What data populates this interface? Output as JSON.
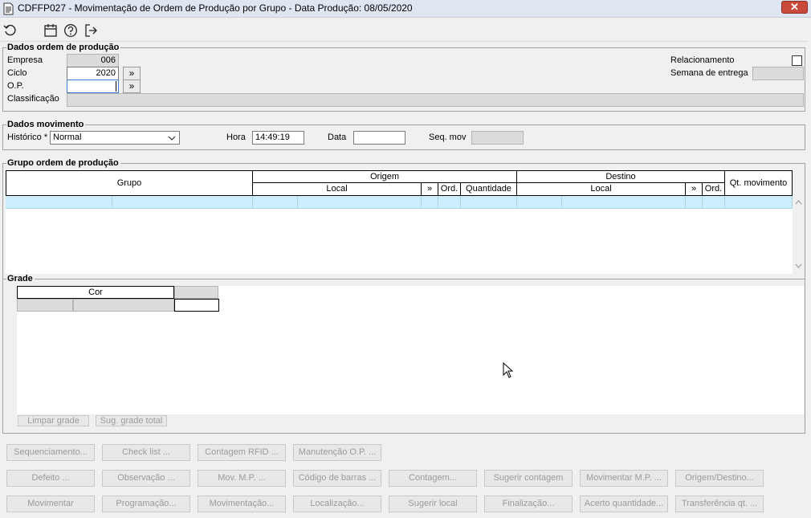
{
  "window": {
    "title": "CDFFP027 - Movimentação de Ordem de Produção por Grupo - Data Produção: 08/05/2020",
    "close_label": "✕"
  },
  "toolbar": {
    "icons": [
      "refresh-icon",
      "calendar-icon",
      "help-icon",
      "exit-icon"
    ]
  },
  "dados_ordem": {
    "title": "Dados ordem de produção",
    "empresa_label": "Empresa",
    "empresa_value": "006",
    "ciclo_label": "Ciclo",
    "ciclo_value": "2020",
    "op_label": "O.P.",
    "op_value": "",
    "classificacao_label": "Classificação",
    "relacionamento_label": "Relacionamento",
    "semana_label": "Semana de entrega",
    "lookup_glyph": "»"
  },
  "dados_movimento": {
    "title": "Dados movimento",
    "historico_label": "Histórico *",
    "historico_value": "Normal",
    "hora_label": "Hora",
    "hora_value": "14:49:19",
    "data_label": "Data",
    "data_value": "",
    "seq_label": "Seq. mov"
  },
  "grupo_ordem": {
    "title": "Grupo ordem de produção",
    "col_grupo": "Grupo",
    "col_origem": "Origem",
    "col_destino": "Destino",
    "col_qt_movimento": "Qt. movimento",
    "sub_local": "Local",
    "sub_lookup": "»",
    "sub_ord": "Ord.",
    "sub_quantidade": "Quantidade"
  },
  "grade": {
    "title": "Grade",
    "col_cor": "Cor",
    "limpar_label": "Limpar grade",
    "sugerir_total_label": "Sug. grade total"
  },
  "buttons": {
    "row1": [
      "Sequenciamento...",
      "Check list ...",
      "Contagem RFID ...",
      "Manutenção O.P. ..."
    ],
    "row2": [
      "Defeito ...",
      "Observação ...",
      "Mov. M.P. ...",
      "Código de barras ...",
      "Contagem...",
      "Sugerir contagem",
      "Movimentar M.P. ...",
      "Origem/Destino..."
    ],
    "row3": [
      "Movimentar",
      "Programação...",
      "Movimentação...",
      "Localização...",
      "Sugerir local",
      "Finalização...",
      "Acerto quantidade...",
      "Transferência qt. ..."
    ]
  }
}
